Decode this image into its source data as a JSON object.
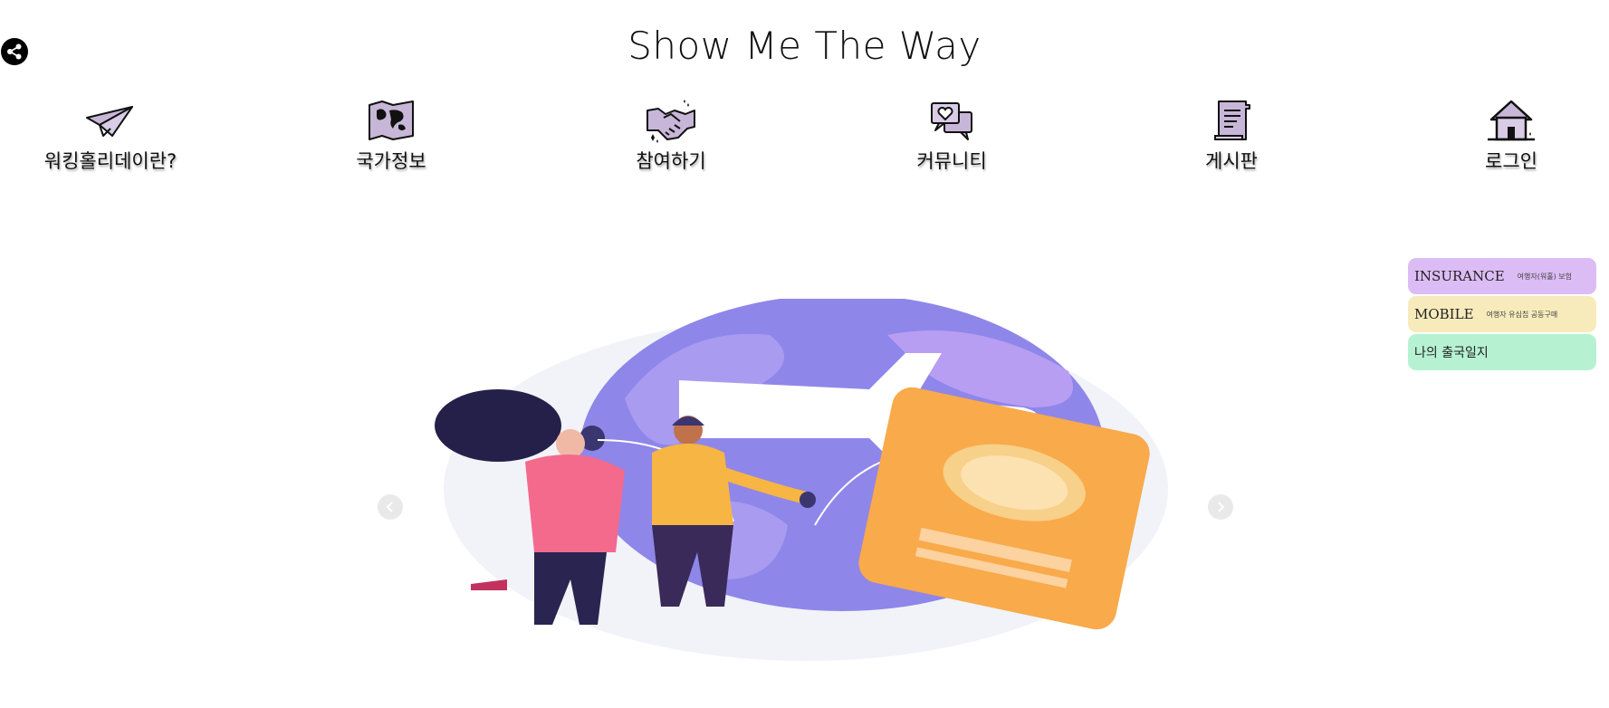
{
  "header": {
    "title": "Show Me The Way",
    "share_icon": "share-icon"
  },
  "nav": {
    "items": [
      {
        "label": "워킹홀리데이란?",
        "icon": "paper-plane-icon"
      },
      {
        "label": "국가정보",
        "icon": "world-map-icon"
      },
      {
        "label": "참여하기",
        "icon": "handshake-icon"
      },
      {
        "label": "커뮤니티",
        "icon": "chat-heart-icon"
      },
      {
        "label": "게시판",
        "icon": "scroll-document-icon"
      },
      {
        "label": "로그인",
        "icon": "house-icon"
      }
    ],
    "icon_fill": "#c8b6d8"
  },
  "side_menu": {
    "items": [
      {
        "main": "INSURANCE",
        "sub": "여행자(워홀) 보험",
        "color": "#dcbcf4"
      },
      {
        "main": "MOBILE",
        "sub": "여행자 유심칩 공동구매",
        "color": "#f7ebbc"
      },
      {
        "main": "나의 출국일지",
        "sub": "",
        "color": "#b6f2d2"
      }
    ]
  },
  "hero": {
    "illustration": "travel-illustration",
    "prev_icon": "chevron-left-icon",
    "next_icon": "chevron-right-icon"
  }
}
